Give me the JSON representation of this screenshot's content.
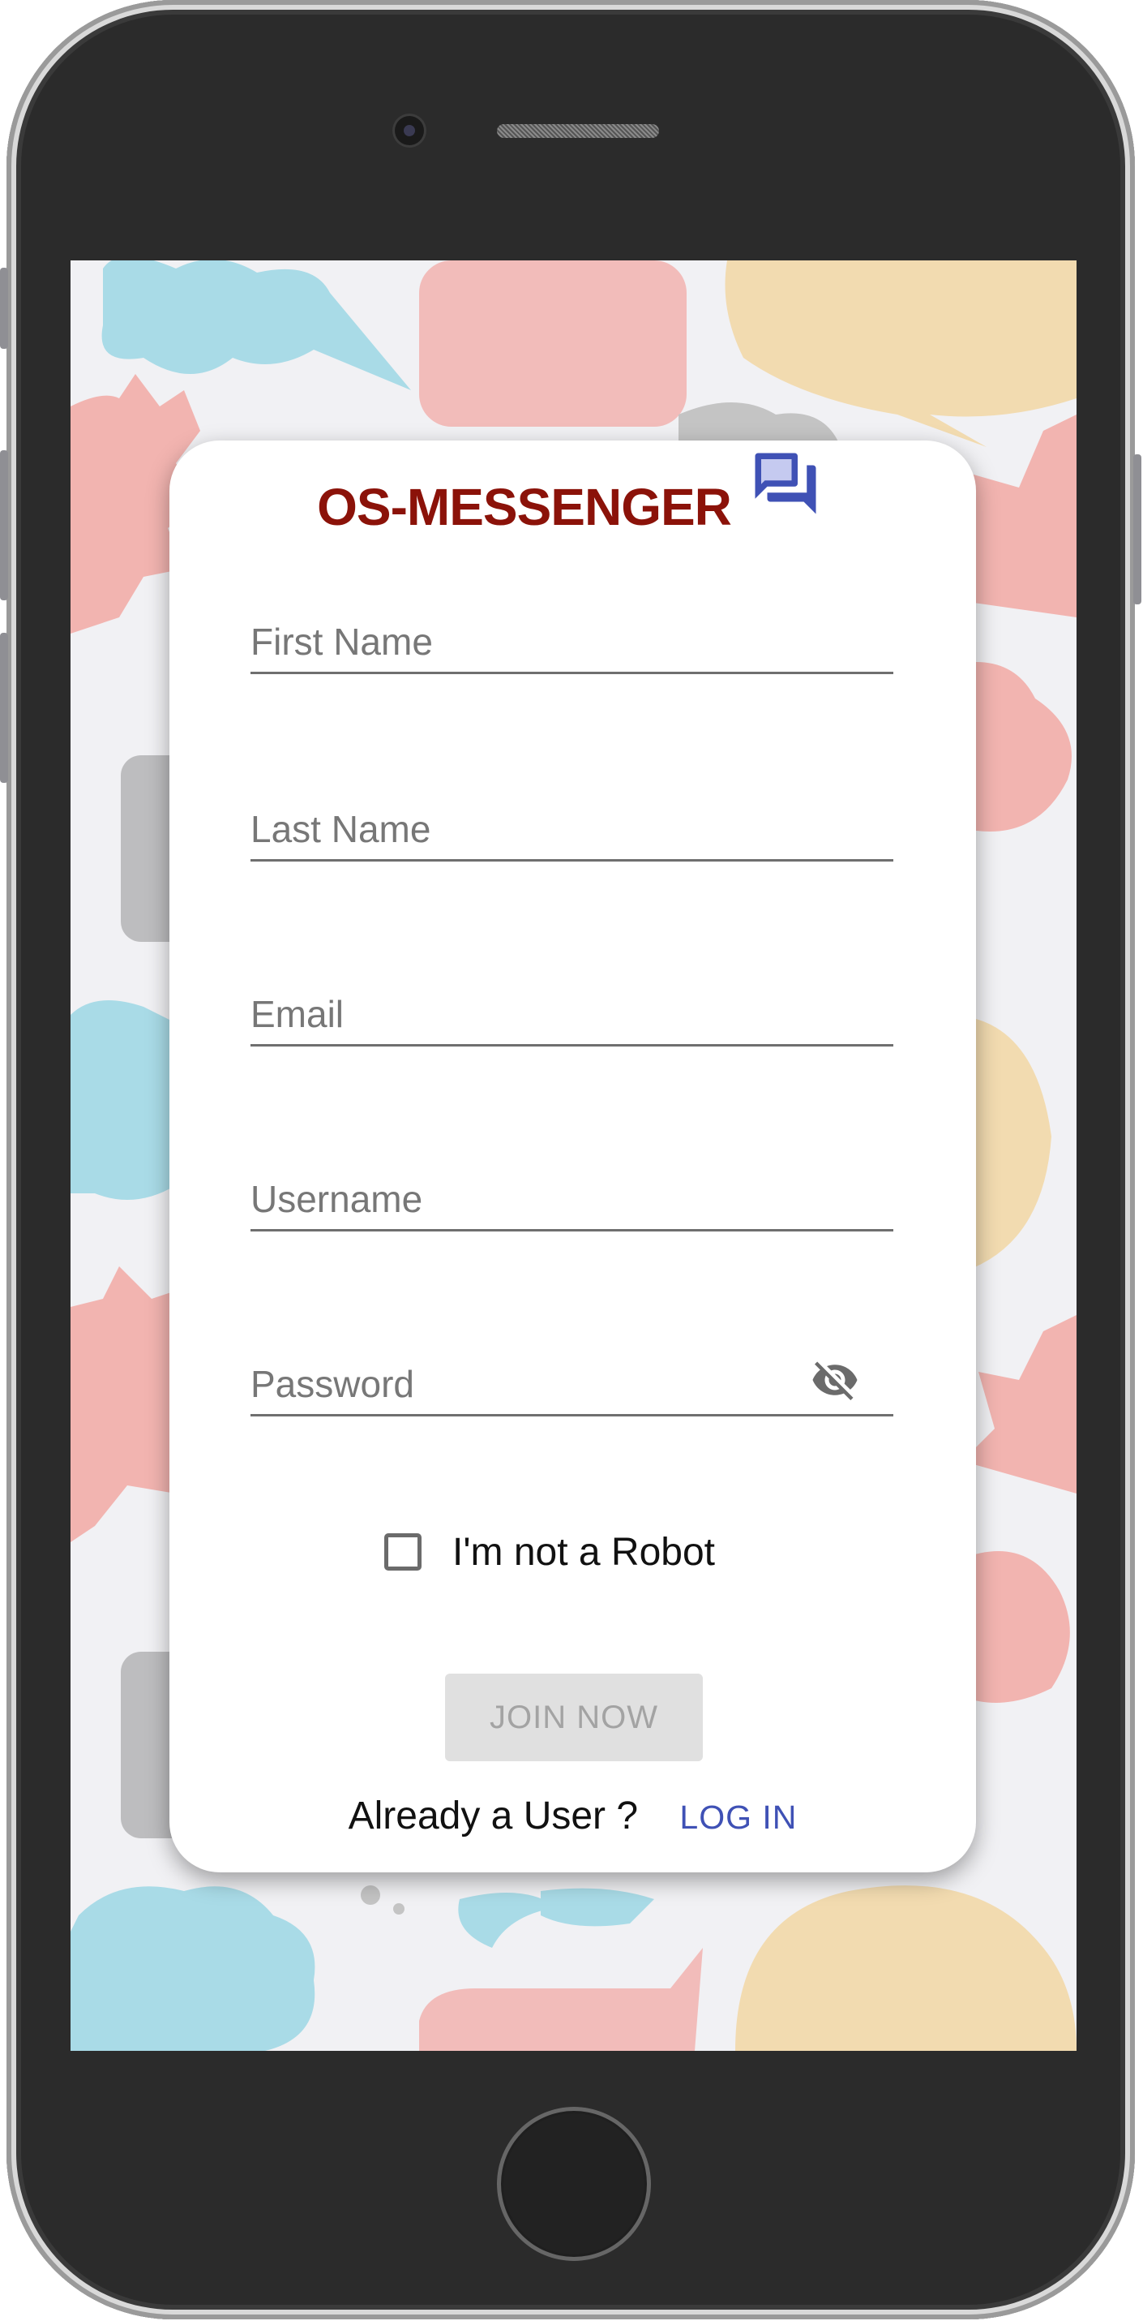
{
  "app": {
    "title": "OS-MESSENGER",
    "accent_color": "#8b1209",
    "icon_color": "#3f51b5"
  },
  "form": {
    "first_name_placeholder": "First Name",
    "last_name_placeholder": "Last Name",
    "email_placeholder": "Email",
    "username_placeholder": "Username",
    "password_placeholder": "Password",
    "robot_label": "I'm not a Robot",
    "robot_checked": false,
    "join_label": "JOIN NOW"
  },
  "footer": {
    "prompt": "Already a User ?",
    "login_label": "LOG IN"
  },
  "icons": {
    "header": "forum-icon",
    "password_toggle": "visibility-off-icon"
  }
}
